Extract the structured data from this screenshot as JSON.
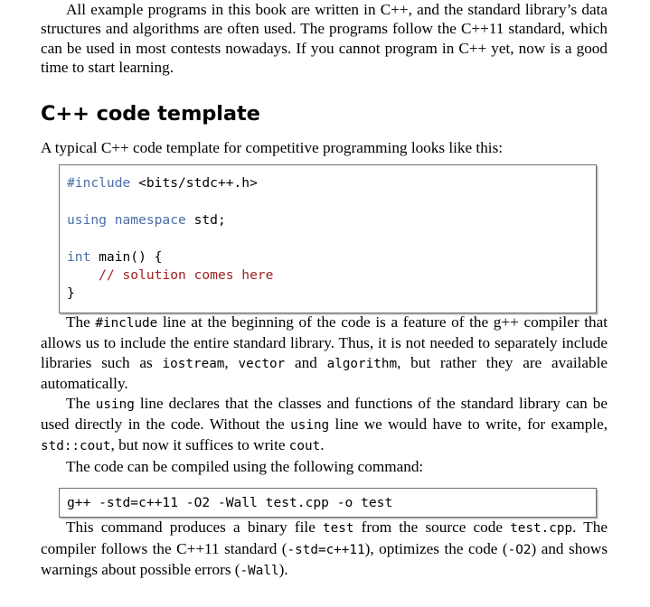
{
  "document": {
    "type": "book-page",
    "paragraphs": {
      "intro": "All example programs in this book are written in C++, and the standard library’s data structures and algorithms are often used. The programs follow the C++11 standard, which can be used in most contests nowadays. If you cannot program in C++ yet, now is a good time to start learning.",
      "template_lead": "A typical C++ code template for competitive programming looks like this:",
      "compile_lead": "The code can be compiled using the following command:"
    },
    "section_heading": "C++ code template",
    "include_paragraph": {
      "part1": "The ",
      "code1": "#include",
      "part2": " line at the beginning of the code is a feature of the g++ compiler that allows us to include the entire standard library. Thus, it is not needed to separately include libraries such as ",
      "code2": "iostream",
      "part3": ", ",
      "code3": "vector",
      "part4": " and ",
      "code4": "algorithm",
      "part5": ", but rather they are available automatically."
    },
    "using_paragraph": {
      "part1": "The ",
      "code1": "using",
      "part2": " line declares that the classes and functions of the standard library can be used directly in the code. Without the ",
      "code2": "using",
      "part3": " line we would have to write, for example, ",
      "code3": "std::cout",
      "part4": ", but now it suffices to write ",
      "code4": "cout",
      "part5": "."
    },
    "result_paragraph": {
      "part1": "This command produces a binary file ",
      "code1": "test",
      "part2": " from the source code ",
      "code2": "test.cpp",
      "part3": ". The compiler follows the C++11 standard (",
      "code3": "-std=c++11",
      "part4": "), optimizes the code (",
      "code4": "-O2",
      "part5": ") and shows warnings about possible errors (",
      "code5": "-Wall",
      "part6": ")."
    },
    "code_block_template": {
      "line1_kw": "#include",
      "line1_rest": " <bits/stdc++.h>",
      "line2": "",
      "line3_kw": "using namespace",
      "line3_rest": " std;",
      "line4": "",
      "line5_kw": "int",
      "line5_rest": " main() {",
      "line6_indent": "    ",
      "line6_comment": "// solution comes here",
      "line7": "}"
    },
    "code_block_command": {
      "line1": "g++ -std=c++11 -O2 -Wall test.cpp -o test"
    },
    "colors": {
      "keyword": "#4a6ea8",
      "comment": "#a02020",
      "text": "#000000",
      "box_border": "#6e6e6e",
      "background": "#ffffff"
    }
  }
}
